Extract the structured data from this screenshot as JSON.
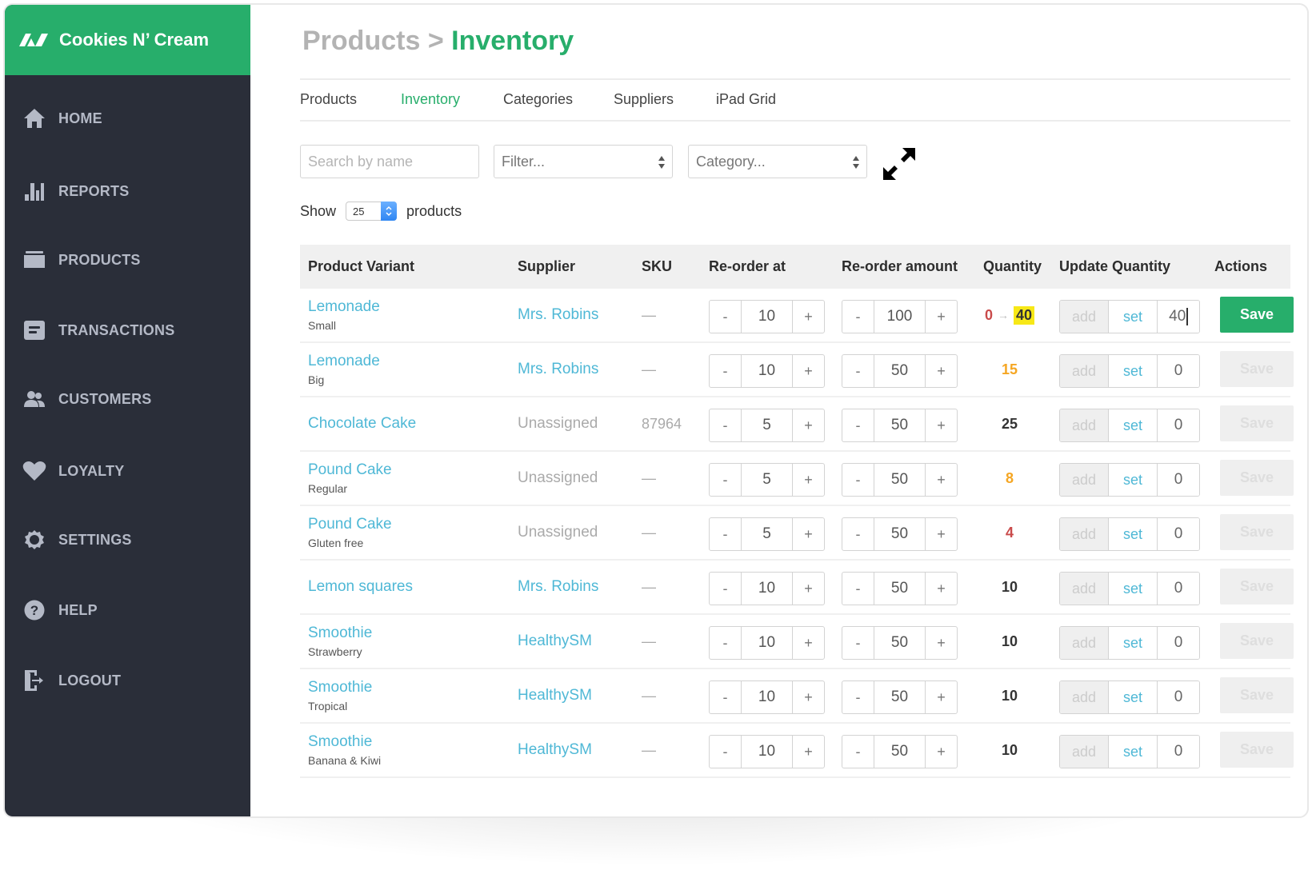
{
  "app": {
    "name": "Cookies N’ Cream",
    "brand_color": "#27ae6b",
    "sidebar_bg": "#2a2e39"
  },
  "sidebar": {
    "items": [
      {
        "label": "HOME",
        "icon": "home-icon"
      },
      {
        "label": "REPORTS",
        "icon": "bar-chart-icon"
      },
      {
        "label": "PRODUCTS",
        "icon": "box-icon"
      },
      {
        "label": "TRANSACTIONS",
        "icon": "receipt-icon"
      },
      {
        "label": "CUSTOMERS",
        "icon": "users-icon"
      },
      {
        "label": "LOYALTY",
        "icon": "heart-icon"
      },
      {
        "label": "SETTINGS",
        "icon": "gear-icon"
      },
      {
        "label": "HELP",
        "icon": "help-icon"
      },
      {
        "label": "LOGOUT",
        "icon": "logout-icon"
      }
    ]
  },
  "header": {
    "breadcrumb_parent": "Products",
    "breadcrumb_sep": ">",
    "breadcrumb_current": "Inventory"
  },
  "tabs": [
    {
      "label": "Products",
      "active": false
    },
    {
      "label": "Inventory",
      "active": true
    },
    {
      "label": "Categories",
      "active": false
    },
    {
      "label": "Suppliers",
      "active": false
    },
    {
      "label": "iPad Grid",
      "active": false
    }
  ],
  "filters": {
    "search_placeholder": "Search by name",
    "filter_value": "Filter...",
    "category_value": "Category...",
    "show_label": "Show",
    "show_value": "25",
    "show_suffix": "products"
  },
  "table": {
    "columns": [
      "Product Variant",
      "Supplier",
      "SKU",
      "Re-order at",
      "Re-order amount",
      "Quantity",
      "Update Quantity",
      "Actions"
    ],
    "add_label": "add",
    "set_label": "set",
    "save_label": "Save",
    "qty_colors": {
      "critical": "#c94a4a",
      "low": "#f5a623",
      "ok": "#333333"
    },
    "rows": [
      {
        "name": "Lemonade",
        "variant": "Small",
        "supplier": "Mrs. Robins",
        "sku": "—",
        "reorder_at": "10",
        "reorder_amount": "100",
        "quantity": "0",
        "quantity_new": "40",
        "qty_status": "critical",
        "update_value": "40",
        "save_enabled": true
      },
      {
        "name": "Lemonade",
        "variant": "Big",
        "supplier": "Mrs. Robins",
        "sku": "—",
        "reorder_at": "10",
        "reorder_amount": "50",
        "quantity": "15",
        "qty_status": "low",
        "update_value": "0",
        "save_enabled": false
      },
      {
        "name": "Chocolate Cake",
        "variant": "",
        "supplier": "Unassigned",
        "sku": "87964",
        "reorder_at": "5",
        "reorder_amount": "50",
        "quantity": "25",
        "qty_status": "ok",
        "update_value": "0",
        "save_enabled": false
      },
      {
        "name": "Pound Cake",
        "variant": "Regular",
        "supplier": "Unassigned",
        "sku": "—",
        "reorder_at": "5",
        "reorder_amount": "50",
        "quantity": "8",
        "qty_status": "low",
        "update_value": "0",
        "save_enabled": false
      },
      {
        "name": "Pound Cake",
        "variant": "Gluten free",
        "supplier": "Unassigned",
        "sku": "—",
        "reorder_at": "5",
        "reorder_amount": "50",
        "quantity": "4",
        "qty_status": "critical",
        "update_value": "0",
        "save_enabled": false
      },
      {
        "name": "Lemon squares",
        "variant": "",
        "supplier": "Mrs. Robins",
        "sku": "—",
        "reorder_at": "10",
        "reorder_amount": "50",
        "quantity": "10",
        "qty_status": "ok",
        "update_value": "0",
        "save_enabled": false
      },
      {
        "name": "Smoothie",
        "variant": "Strawberry",
        "supplier": "HealthySM",
        "sku": "—",
        "reorder_at": "10",
        "reorder_amount": "50",
        "quantity": "10",
        "qty_status": "ok",
        "update_value": "0",
        "save_enabled": false
      },
      {
        "name": "Smoothie",
        "variant": "Tropical",
        "supplier": "HealthySM",
        "sku": "—",
        "reorder_at": "10",
        "reorder_amount": "50",
        "quantity": "10",
        "qty_status": "ok",
        "update_value": "0",
        "save_enabled": false
      },
      {
        "name": "Smoothie",
        "variant": "Banana & Kiwi",
        "supplier": "HealthySM",
        "sku": "—",
        "reorder_at": "10",
        "reorder_amount": "50",
        "quantity": "10",
        "qty_status": "ok",
        "update_value": "0",
        "save_enabled": false
      }
    ]
  }
}
